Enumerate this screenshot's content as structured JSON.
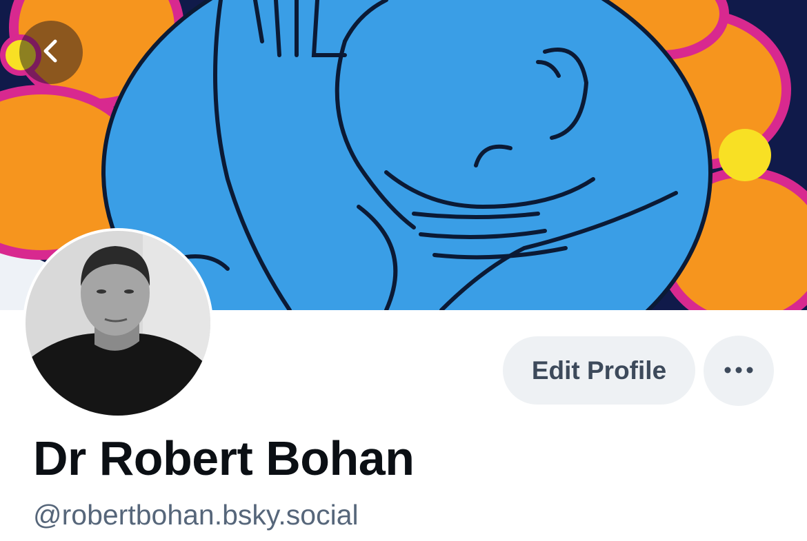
{
  "profile": {
    "display_name": "Dr Robert Bohan",
    "handle": "@robertbohan.bsky.social",
    "edit_label": "Edit Profile"
  },
  "icons": {
    "back": "chevron-left-icon",
    "more": "ellipsis-icon"
  },
  "colors": {
    "button_bg": "#eef1f4",
    "button_text": "#3d4a5b",
    "name_text": "#0b0f14",
    "handle_text": "#56667a",
    "banner_blue": "#3a9ee6",
    "banner_orange": "#f6951e",
    "banner_magenta": "#d8298f",
    "banner_navy": "#101a4a"
  }
}
